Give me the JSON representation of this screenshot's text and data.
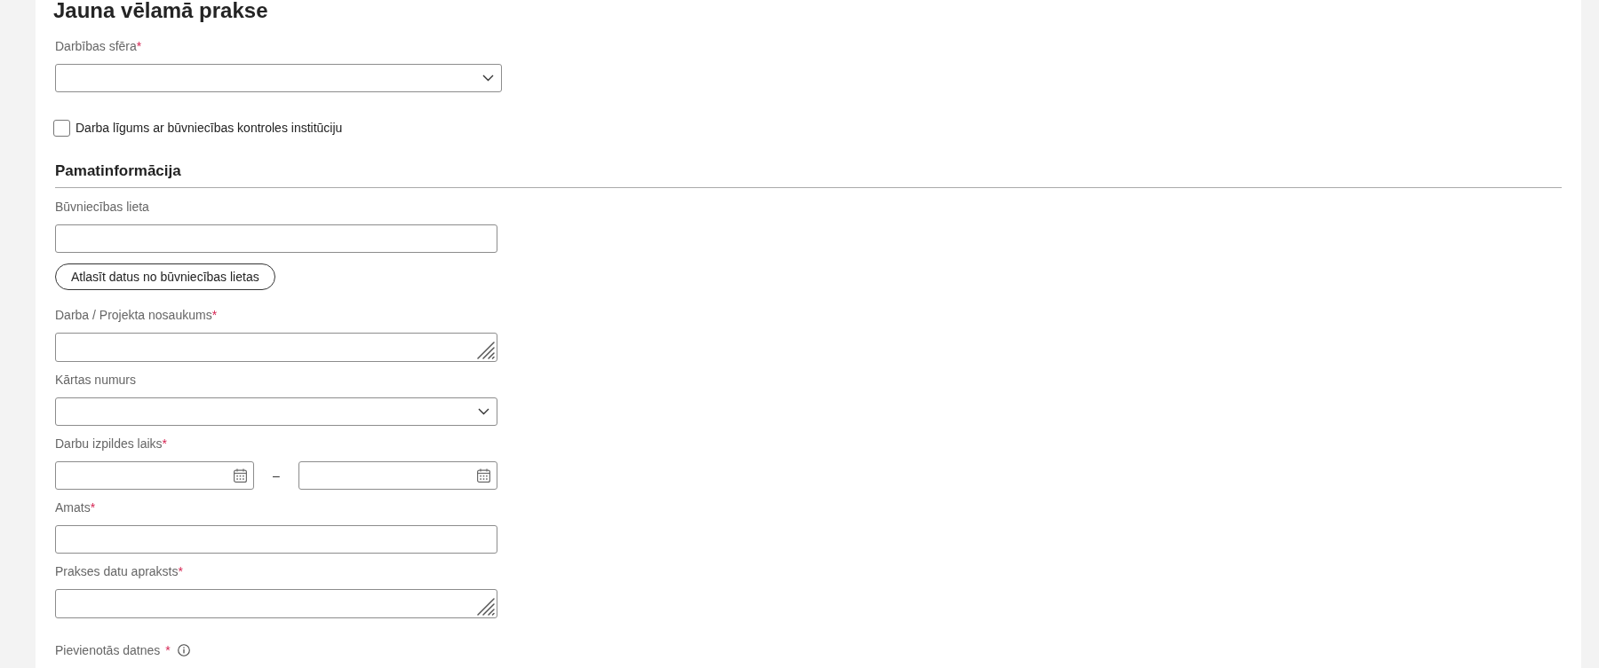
{
  "title": "Jauna vēlamā prakse",
  "top": [
    {
      "kind": "select",
      "label": "Darbības sfēra",
      "mark": "*"
    },
    {
      "kind": "checkbox",
      "label": "Darba līgums ar būvniecības kontroles institūciju",
      "checked": false
    }
  ],
  "section": {
    "heading": "Pamatinformācija",
    "items": [
      {
        "kind": "text",
        "label": "Būvniecības lieta"
      },
      {
        "kind": "button",
        "label": "Atlasīt datus no būvniecības lietas"
      },
      {
        "kind": "textarea",
        "label": "Darba / Projekta nosaukums",
        "mark": "*"
      },
      {
        "kind": "select",
        "label": "Kārtas numurs"
      },
      {
        "kind": "date_range",
        "label": "Darbu izpildes laiks",
        "mark": "*",
        "separator": "–"
      },
      {
        "kind": "text",
        "label": "Amats",
        "mark": "*"
      },
      {
        "kind": "textarea",
        "label": "Prakses datu apraksts",
        "mark": "*"
      },
      {
        "kind": "files",
        "label": "Pievienotās datnes",
        "mark": "*"
      }
    ]
  }
}
